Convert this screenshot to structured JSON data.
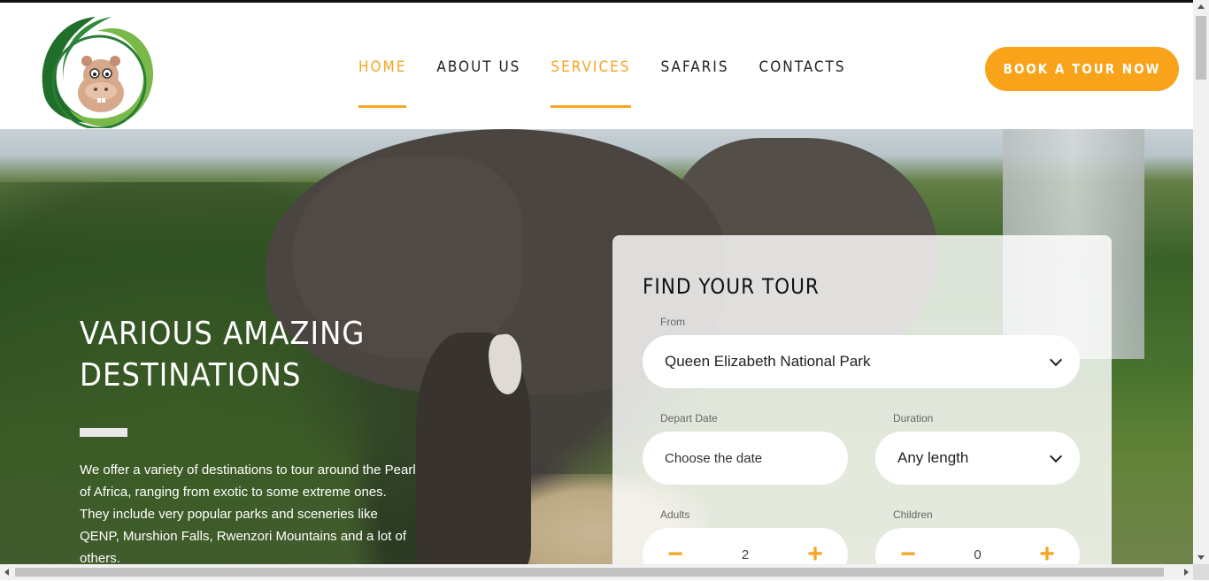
{
  "header": {
    "logo_alt": "Hippo logo",
    "nav": [
      {
        "label": "HOME",
        "active": true
      },
      {
        "label": "ABOUT US",
        "active": false
      },
      {
        "label": "SERVICES",
        "active": true
      },
      {
        "label": "SAFARIS",
        "active": false
      },
      {
        "label": "CONTACTS",
        "active": false
      }
    ],
    "cta_label": "BOOK A TOUR NOW"
  },
  "hero": {
    "title_line1": "VARIOUS AMAZING",
    "title_line2": "DESTINATIONS",
    "text": "We offer a variety of destinations to tour around the Pearl of Africa, ranging from exotic to some extreme ones. They include very popular parks and sceneries like QENP, Murshion Falls, Rwenzori Mountains and a lot of others."
  },
  "tour_form": {
    "title": "FIND YOUR TOUR",
    "from_label": "From",
    "from_value": "Queen Elizabeth National Park",
    "depart_label": "Depart Date",
    "depart_placeholder": "Choose the date",
    "duration_label": "Duration",
    "duration_value": "Any length",
    "adults_label": "Adults",
    "adults_value": "2",
    "children_label": "Children",
    "children_value": "0"
  },
  "colors": {
    "accent": "#f9a31a",
    "nav_text": "#222222",
    "logo_green": "#1f7a2e"
  }
}
